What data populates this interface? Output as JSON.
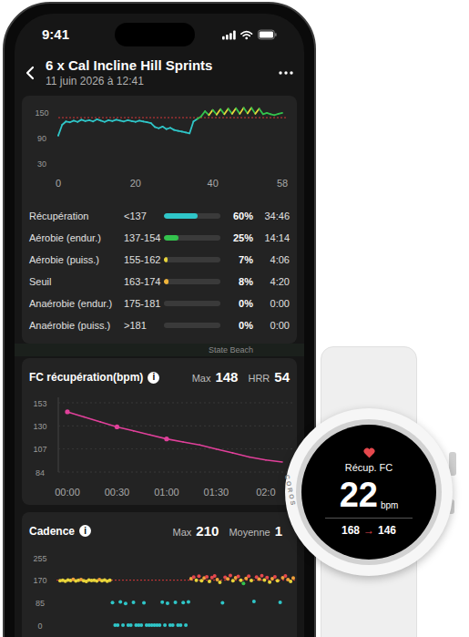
{
  "status_bar": {
    "time": "9:41"
  },
  "header": {
    "title": "6 x Cal Incline Hill Sprints",
    "subtitle": "11 juin 2026 à 12:41"
  },
  "hr_chart": {
    "y_ticks": [
      "150",
      "90",
      "30"
    ],
    "y_tick_values": [
      150,
      90,
      30
    ],
    "x_ticks": [
      "0",
      "20",
      "40",
      "58"
    ],
    "x_tick_values": [
      0,
      20,
      40,
      58
    ],
    "threshold": 137,
    "zone_bounds": [
      137,
      155,
      163,
      175,
      182
    ],
    "zone_colors": [
      "#2fc6c8",
      "#33c24d",
      "#e8d43a",
      "#f0b43a",
      "#e07a3a",
      "#e5484d"
    ],
    "values": [
      95,
      120,
      128,
      126,
      130,
      127,
      132,
      129,
      131,
      128,
      133,
      130,
      127,
      131,
      129,
      132,
      130,
      128,
      131,
      129,
      127,
      130,
      128,
      126,
      124,
      115,
      112,
      116,
      110,
      113,
      108,
      106,
      104,
      102,
      100,
      128,
      134,
      140,
      152,
      143,
      155,
      144,
      157,
      145,
      158,
      146,
      159,
      146,
      160,
      147,
      160,
      146,
      158,
      145,
      148,
      145,
      143,
      146,
      148
    ]
  },
  "zones": [
    {
      "name": "Récupération",
      "range": "<137",
      "level": 0.6,
      "percent": "60%",
      "time": "34:46",
      "color": "#2fc6c8"
    },
    {
      "name": "Aérobie (endur.)",
      "range": "137-154",
      "level": 0.25,
      "percent": "25%",
      "time": "14:14",
      "color": "#33c24d"
    },
    {
      "name": "Aérobie (puiss.)",
      "range": "155-162",
      "level": 0.07,
      "percent": "7%",
      "time": "4:06",
      "color": "#e8d43a"
    },
    {
      "name": "Seuil",
      "range": "163-174",
      "level": 0.08,
      "percent": "8%",
      "time": "4:20",
      "color": "#f0b43a"
    },
    {
      "name": "Anaérobie (endur.)",
      "range": "175-181",
      "level": 0,
      "percent": "0%",
      "time": "0:00",
      "color": "#e07a3a"
    },
    {
      "name": "Anaérobie (puiss.)",
      "range": ">181",
      "level": 0,
      "percent": "0%",
      "time": "0:00",
      "color": "#e5484d"
    }
  ],
  "map_label": "State Beach",
  "recovery": {
    "title": "FC récupération(bpm)",
    "info": "i",
    "max_label": "Max",
    "max": "148",
    "hrr_label": "HRR",
    "hrr": "54",
    "y_ticks": [
      "153",
      "130",
      "107",
      "84"
    ],
    "y_tick_values": [
      153,
      130,
      107,
      84
    ],
    "x_ticks": [
      "00:00",
      "00:30",
      "01:00",
      "01:30",
      "02:0"
    ],
    "x_tick_seconds": [
      0,
      30,
      60,
      90,
      120
    ],
    "step_seconds": 10,
    "values": [
      144,
      139,
      134,
      129,
      125,
      121,
      117,
      114,
      111,
      107,
      103,
      99,
      96,
      94
    ],
    "dot_indices": [
      0,
      3,
      6
    ]
  },
  "cadence": {
    "title": "Cadence",
    "info": "i",
    "max_label": "Max",
    "max": "210",
    "avg_label": "Moyenne",
    "avg": "1",
    "y_ticks": [
      "255",
      "170",
      "85",
      "0"
    ],
    "y_tick_values": [
      255,
      170,
      85,
      0
    ],
    "reference": 170,
    "color_bands": [
      {
        "min": 180,
        "color": "#e5484d"
      },
      {
        "min": 172,
        "color": "#f0a03a"
      },
      {
        "min": 160,
        "color": "#e8d43a"
      },
      {
        "min": 140,
        "color": "#33c24d"
      },
      {
        "min": 0,
        "color": "#2fc6c8"
      }
    ],
    "values": [
      168,
      170,
      166,
      171,
      169,
      173,
      167,
      170,
      172,
      168,
      165,
      171,
      169,
      170,
      167,
      172,
      168,
      171,
      166,
      170,
      85,
      0,
      0,
      88,
      0,
      82,
      0,
      0,
      86,
      0,
      0,
      0,
      84,
      0,
      0,
      0,
      0,
      0,
      0,
      87,
      0,
      83,
      0,
      0,
      86,
      0,
      0,
      85,
      0,
      88,
      176,
      182,
      170,
      185,
      168,
      178,
      183,
      165,
      180,
      186,
      172,
      162,
      84,
      181,
      175,
      188,
      168,
      179,
      184,
      170,
      158,
      177,
      185,
      169,
      90,
      182,
      174,
      187,
      171,
      180,
      163,
      176,
      183,
      168,
      86,
      179,
      186,
      172,
      165,
      178
    ]
  },
  "watch": {
    "brand": "COROS",
    "title": "Récup. FC",
    "value": "22",
    "unit": "bpm",
    "from": "168",
    "arrow": "→",
    "to": "146"
  }
}
